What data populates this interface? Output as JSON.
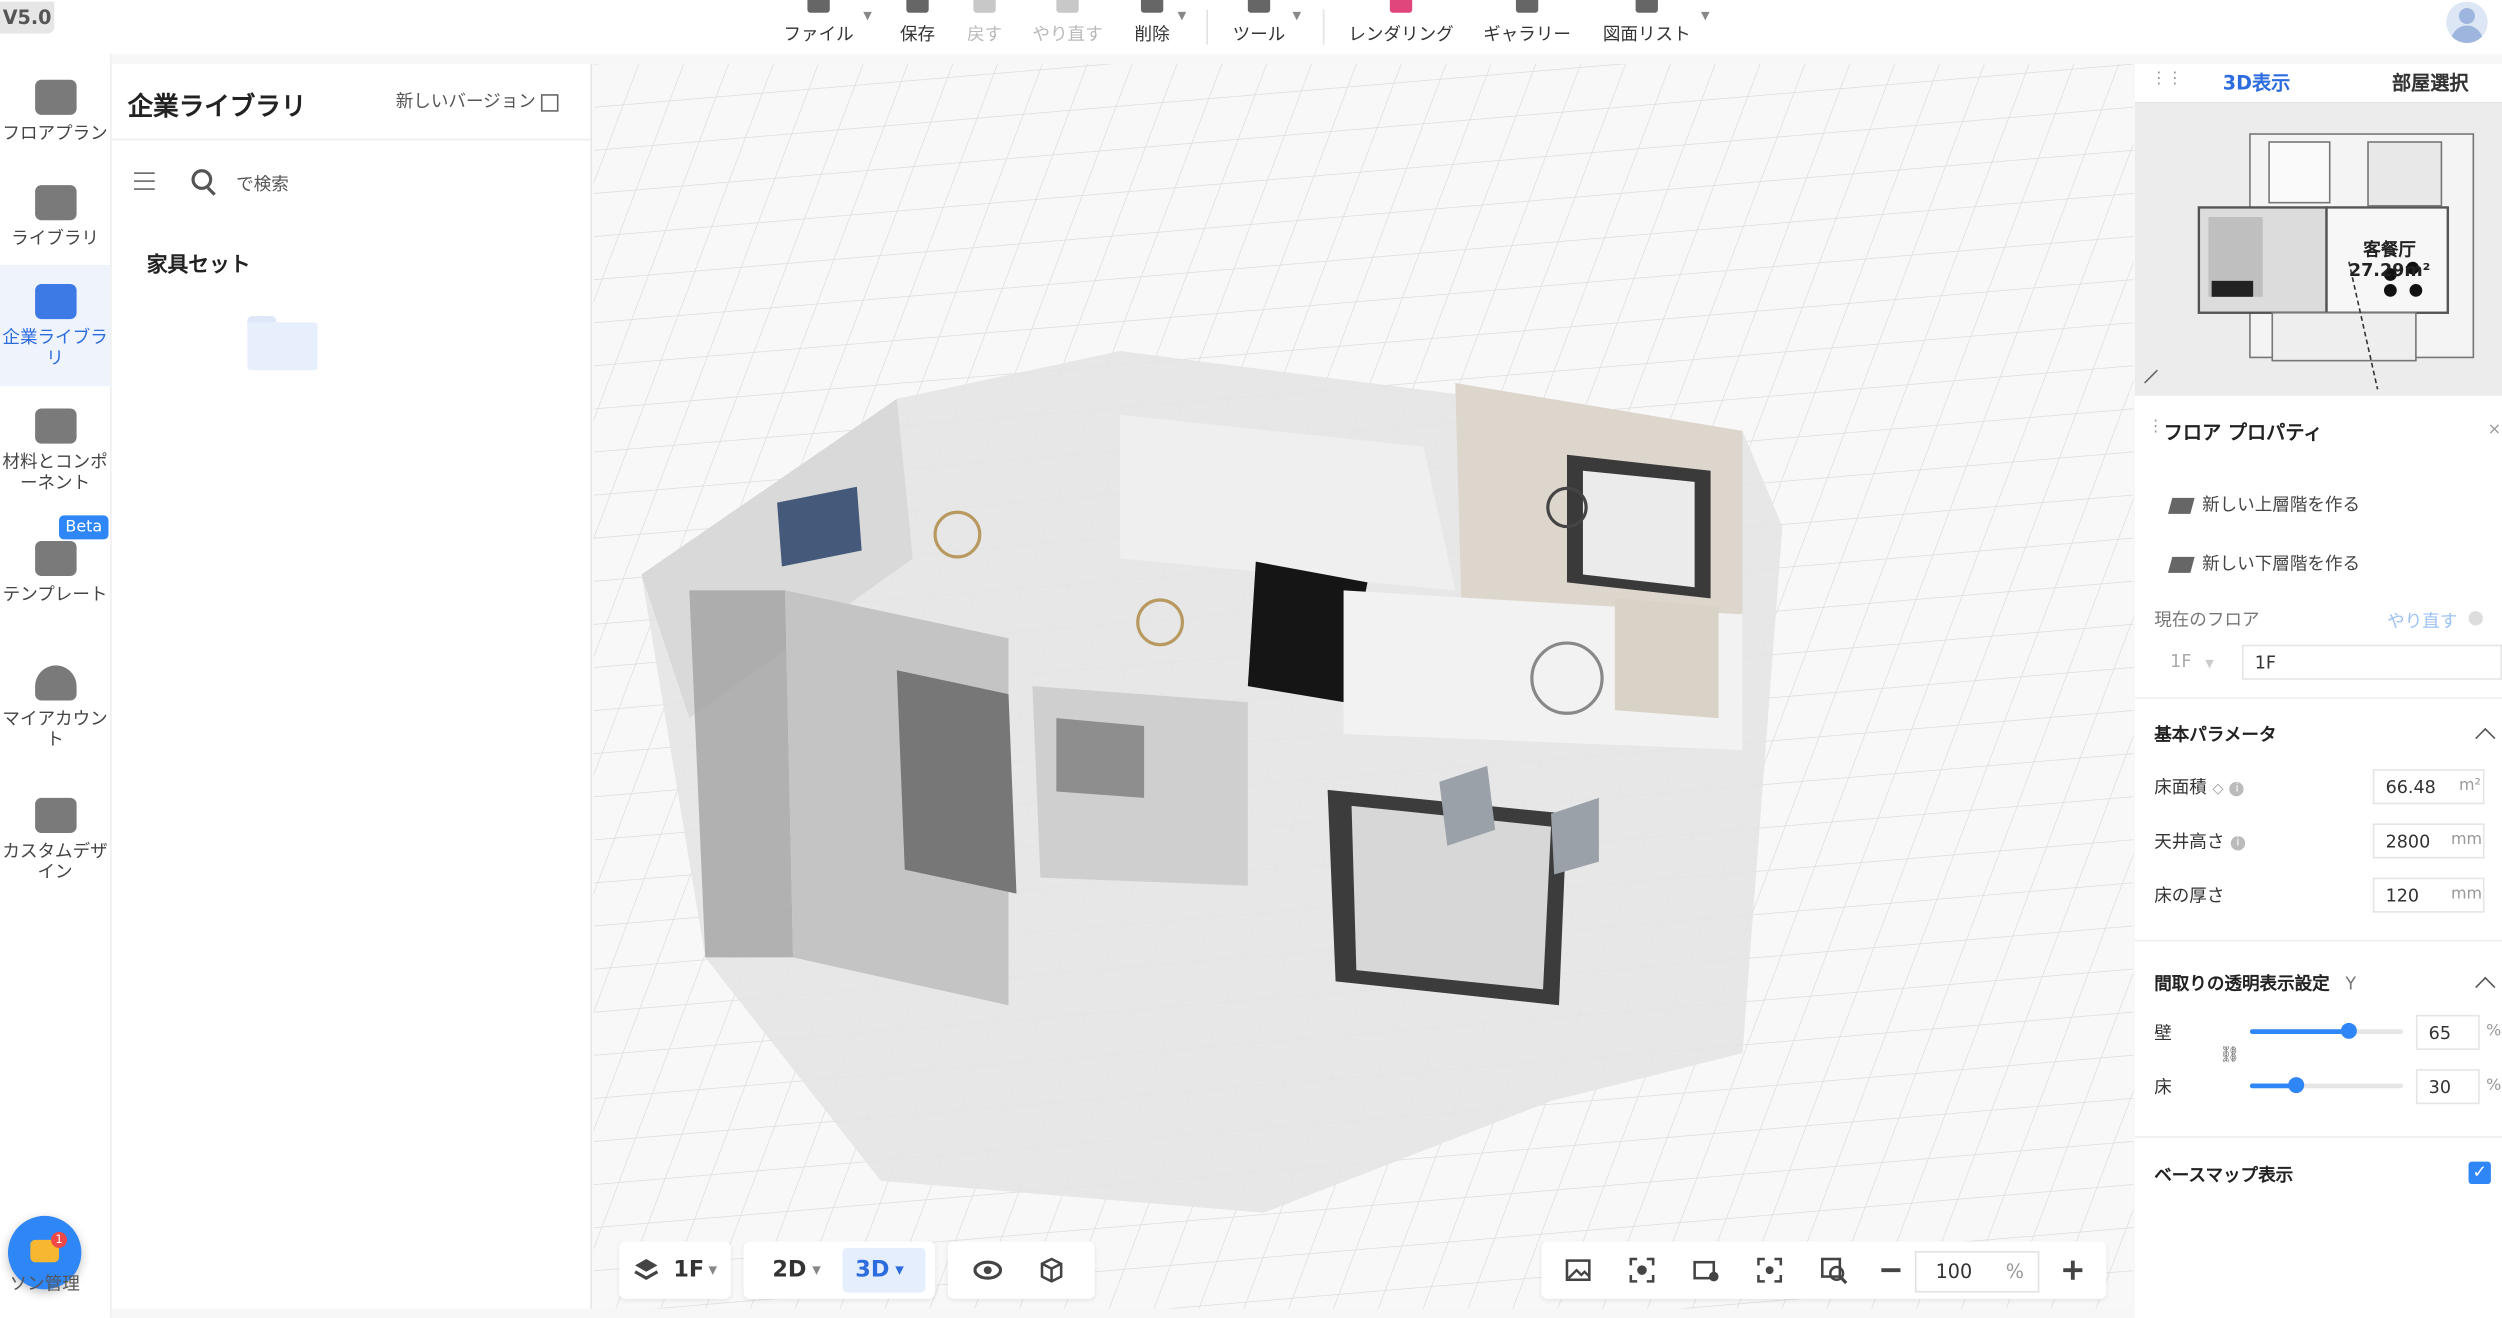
{
  "version": "V5.0",
  "toolbar": {
    "file": "ファイル",
    "save": "保存",
    "undo": "戻す",
    "redo": "やり直す",
    "delete": "削除",
    "tools": "ツール",
    "rendering": "レンダリング",
    "gallery": "ギャラリー",
    "drawing_list": "図面リスト"
  },
  "nav": {
    "floorplan": "フロアプラン",
    "library": "ライブラリ",
    "enterprise_library": "企業ライブラリ",
    "materials": "材料とコンポーネント",
    "templates": "テンプレート",
    "my_account": "マイアカウント",
    "custom_design": "カスタムデザイン",
    "beta": "Beta",
    "chat_label": "ソン管理",
    "chat_badge": "1"
  },
  "library": {
    "title": "企業ライブラリ",
    "new_version": "新しいバージョン",
    "search_placeholder": "で検索",
    "set_label": "家具セット"
  },
  "viewport_controls": {
    "floor": "1F",
    "mode_2d": "2D",
    "mode_3d": "3D",
    "zoom": "100",
    "zoom_unit": "%"
  },
  "right_panel": {
    "tab_3d": "3D表示",
    "tab_room": "部屋選択",
    "room_name": "客餐厅",
    "room_area": "27.29m²",
    "properties_title": "フロア プロパティ",
    "new_upper_floor": "新しい上層階を作る",
    "new_lower_floor": "新しい下層階を作る",
    "current_floor_label": "現在のフロア",
    "current_floor_redo": "やり直す",
    "floor_select": "1F",
    "floor_name": "1F",
    "basic_params": "基本パラメータ",
    "floor_area_label": "床面積",
    "floor_area_value": "66.48",
    "floor_area_unit": "m²",
    "ceiling_label": "天井高さ",
    "ceiling_value": "2800",
    "ceiling_unit": "mm",
    "thickness_label": "床の厚さ",
    "thickness_value": "120",
    "thickness_unit": "mm",
    "transparency_title": "間取りの透明表示設定",
    "transparency_hotkey": "Y",
    "wall_label": "壁",
    "wall_value": "65",
    "floor_label": "床",
    "floor_value": "30",
    "percent": "%",
    "basemap_label": "ベースマップ表示",
    "basemap_checked": true,
    "wall_fraction": 0.65,
    "floor_fraction": 0.3
  }
}
